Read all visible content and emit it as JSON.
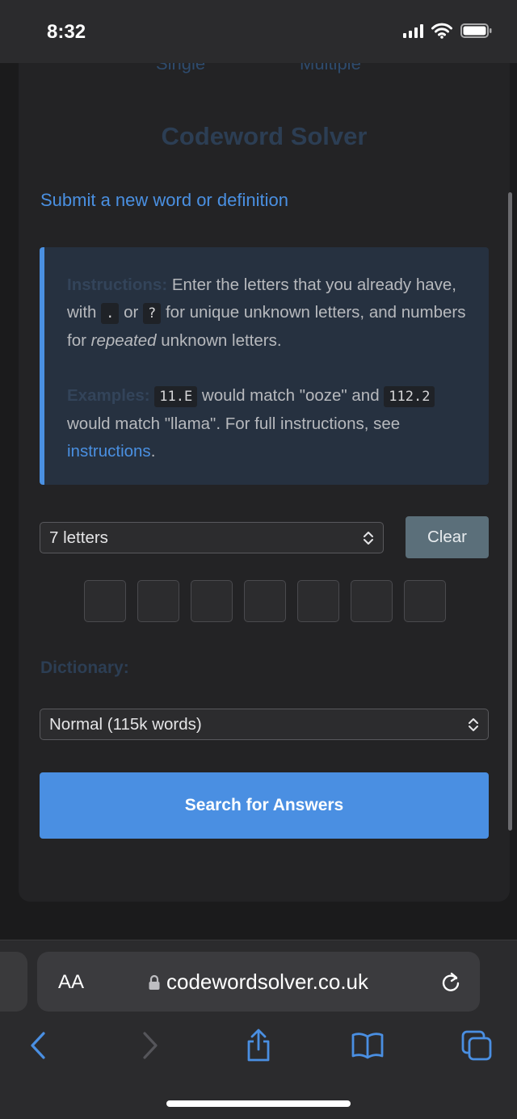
{
  "status": {
    "time": "8:32"
  },
  "tabs": {
    "left": "Single",
    "right": "Multiple"
  },
  "page": {
    "title": "Codeword Solver",
    "submit_link": "Submit a new word or definition"
  },
  "instructions": {
    "label": "Instructions:",
    "t1": " Enter the letters that you already have, with ",
    "code_dot": ".",
    "t2": " or ",
    "code_q": "?",
    "t3": " for unique unknown letters, and numbers for ",
    "t3_em": "repeated",
    "t4": " unknown letters.",
    "examples_label": "Examples:",
    "code_ex1": "11.E",
    "e1": " would match \"ooze\" and ",
    "code_ex2": "112.2",
    "e2": " would match \"llama\". For full instructions, see ",
    "link": "instructions",
    "e3": "."
  },
  "form": {
    "length_select": "7 letters",
    "clear_button": "Clear",
    "letter_count": 7,
    "dictionary_label": "Dictionary:",
    "dictionary_select": "Normal (115k words)",
    "search_button": "Search for Answers"
  },
  "browser": {
    "aa_label": "AA",
    "url": "codewordsolver.co.uk"
  },
  "colors": {
    "accent": "#4a90e2",
    "background": "#1b1b1c",
    "card": "#232325",
    "clear_button": "#5b6f7a"
  },
  "icons": [
    "lock-icon",
    "reload-icon",
    "back-icon",
    "forward-icon",
    "share-icon",
    "bookmarks-icon",
    "tabs-icon"
  ]
}
